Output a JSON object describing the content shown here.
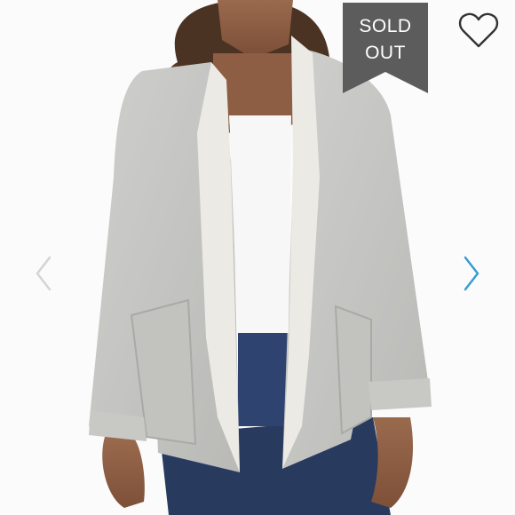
{
  "listing": {
    "badge_text": "SOLD OUT",
    "badge_color": "#5c5c5c",
    "accent_color": "#3a9bd5"
  },
  "icons": {
    "favorite": "heart-outline-icon",
    "previous": "chevron-left-icon",
    "next": "chevron-right-icon"
  }
}
